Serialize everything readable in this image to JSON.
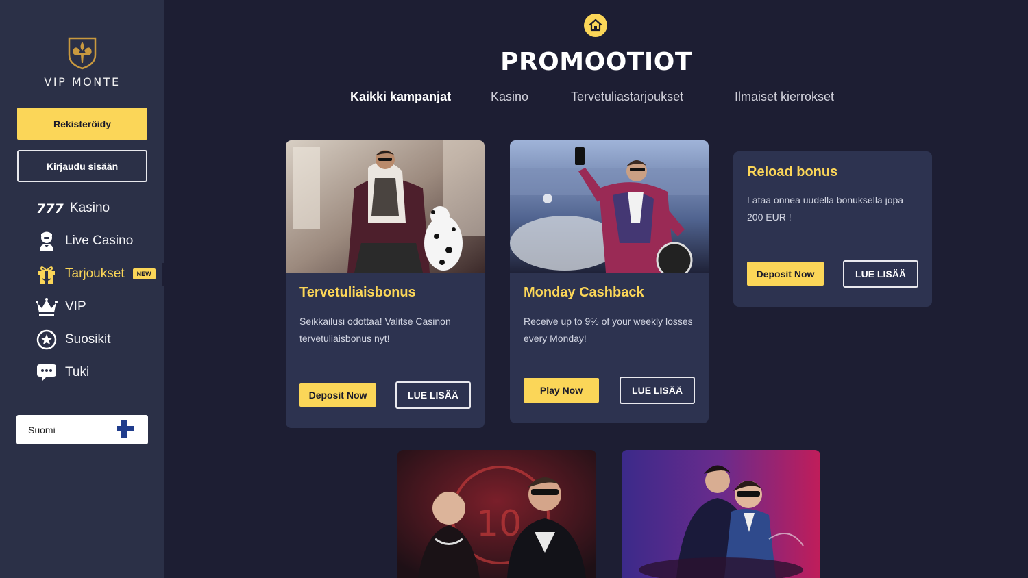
{
  "brand": {
    "logo_text": "VIP MONTE"
  },
  "sidebar": {
    "register_label": "Rekisteröidy",
    "login_label": "Kirjaudu sisään",
    "items": [
      {
        "label": "Kasino",
        "icon": "777-icon"
      },
      {
        "label": "Live Casino",
        "icon": "dealer-icon"
      },
      {
        "label": "Tarjoukset",
        "icon": "gift-icon",
        "badge": "NEW",
        "active": true
      },
      {
        "label": "VIP",
        "icon": "crown-icon"
      },
      {
        "label": "Suosikit",
        "icon": "star-icon"
      },
      {
        "label": "Tuki",
        "icon": "chat-icon"
      }
    ],
    "language": {
      "label": "Suomi",
      "icon": "finland-flag-icon"
    }
  },
  "header": {
    "title": "PROMOOTIOT",
    "tabs": [
      {
        "label": "Kaikki kampanjat",
        "active": true
      },
      {
        "label": "Kasino"
      },
      {
        "label": "Tervetuliastarjoukset"
      },
      {
        "label": "Ilmaiset kierrokset"
      }
    ]
  },
  "promotions": [
    {
      "title": "Tervetuliaisbonus",
      "description": "Seikkailusi odottaa! Valitse Casinon tervetuliaisbonus nyt!",
      "primary_label": "Deposit Now",
      "secondary_label": "LUE LISÄÄ"
    },
    {
      "title": "Monday Cashback",
      "description": "Receive up to 9% of your weekly losses every Monday!",
      "primary_label": "Play Now",
      "secondary_label": "LUE LISÄÄ"
    },
    {
      "title": "Reload bonus",
      "description": "Lataa onnea uudella bonuksella jopa 200 EUR !",
      "primary_label": "Deposit Now",
      "secondary_label": "LUE LISÄÄ"
    }
  ],
  "colors": {
    "accent": "#fbd658",
    "sidebar_bg": "#2b3047",
    "page_bg": "#1d1e33",
    "card_bg": "#2d3350"
  }
}
